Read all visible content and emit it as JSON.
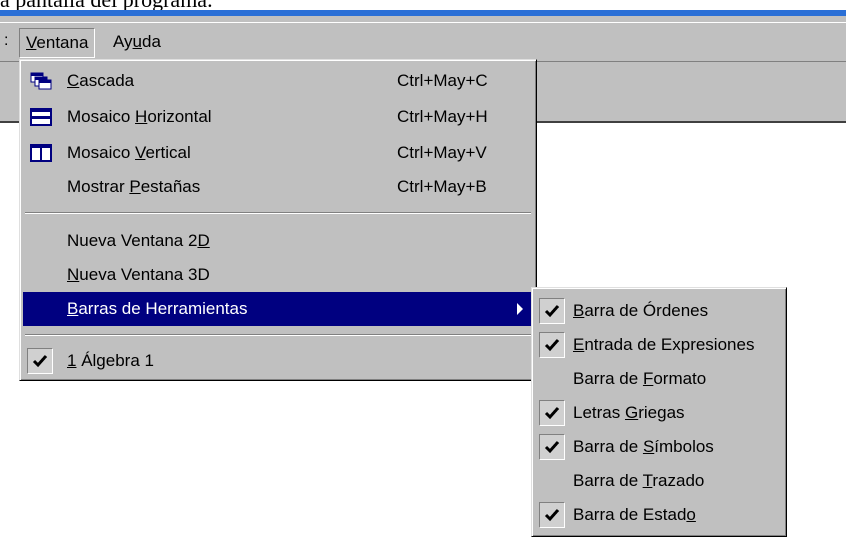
{
  "caption": "a pantalla del programa.",
  "menubar": {
    "stub": ":",
    "items": [
      {
        "pre": "",
        "key": "V",
        "post": "entana"
      },
      {
        "pre": "Ay",
        "key": "u",
        "post": "da"
      }
    ]
  },
  "window_menu": {
    "items": [
      {
        "icon": "cascade-icon",
        "pre": "",
        "key": "C",
        "post": "ascada",
        "shortcut": "Ctrl+May+C"
      },
      {
        "icon": "tile-horizontal-icon",
        "pre": "Mosaico ",
        "key": "H",
        "post": "orizontal",
        "shortcut": "Ctrl+May+H"
      },
      {
        "icon": "tile-vertical-icon",
        "pre": "Mosaico ",
        "key": "V",
        "post": "ertical",
        "shortcut": "Ctrl+May+V"
      },
      {
        "pre": "Mostrar ",
        "key": "P",
        "post": "estañas",
        "shortcut": "Ctrl+May+B"
      },
      {
        "pre": "Nueva Ventana 2",
        "key": "D",
        "post": ""
      },
      {
        "pre": "",
        "key": "N",
        "post": "ueva Ventana 3D"
      },
      {
        "pre": "",
        "key": "B",
        "post": "arras de Herramientas",
        "highlighted": true
      },
      {
        "pre": "",
        "key": "1",
        "post": " Álgebra 1",
        "checked": true
      }
    ]
  },
  "toolbars_submenu": {
    "items": [
      {
        "pre": "",
        "key": "B",
        "post": "arra de Órdenes",
        "checked": true
      },
      {
        "pre": "",
        "key": "E",
        "post": "ntrada de Expresiones",
        "checked": true
      },
      {
        "pre": "Barra de ",
        "key": "F",
        "post": "ormato",
        "checked": false
      },
      {
        "pre": "Letras ",
        "key": "G",
        "post": "riegas",
        "checked": true
      },
      {
        "pre": "Barra de ",
        "key": "S",
        "post": "ímbolos",
        "checked": true
      },
      {
        "pre": "Barra de ",
        "key": "T",
        "post": "razado",
        "checked": false
      },
      {
        "pre": "Barra de Estad",
        "key": "o",
        "post": "",
        "checked": true
      }
    ]
  }
}
